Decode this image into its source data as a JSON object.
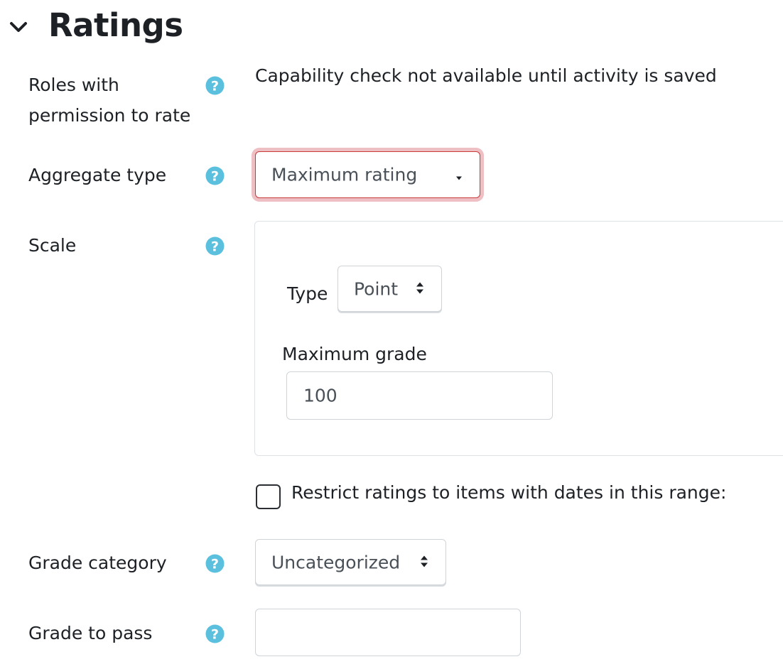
{
  "section": {
    "title": "Ratings",
    "collapse_icon": "chevron-down-icon"
  },
  "fields": {
    "roles": {
      "label_line1": "Roles with",
      "label_line2": "permission to rate",
      "value": "Capability check not available until activity is saved",
      "help_icon": "question-circle-icon"
    },
    "aggregate": {
      "label": "Aggregate type",
      "selected": "Maximum rating",
      "help_icon": "question-circle-icon"
    },
    "scale": {
      "label": "Scale",
      "type_label": "Type",
      "type_selected": "Point",
      "max_grade_label": "Maximum grade",
      "max_grade_value": "100",
      "help_icon": "question-circle-icon"
    },
    "restrict": {
      "label": "Restrict ratings to items with dates in this range:",
      "checked": false
    },
    "grade_category": {
      "label": "Grade category",
      "selected": "Uncategorized",
      "help_icon": "question-circle-icon"
    },
    "grade_to_pass": {
      "label": "Grade to pass",
      "value": "",
      "help_icon": "question-circle-icon"
    }
  },
  "colors": {
    "help_icon": "#5bc0de",
    "invalid_border": "#c93a3a",
    "invalid_glow": "#eebfc3",
    "text": "#1d2125"
  }
}
